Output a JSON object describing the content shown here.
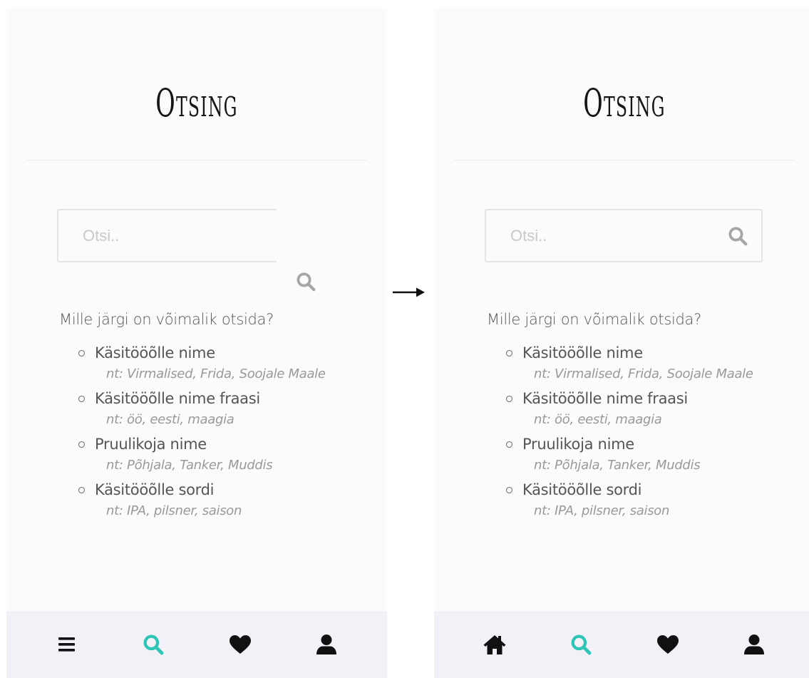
{
  "screens": [
    {
      "title": "Otsing",
      "search": {
        "placeholder": "Otsi.."
      },
      "info": {
        "heading": "Mille järgi on võimalik otsida?",
        "items": [
          {
            "label": "Käsitööõlle nime",
            "example": "nt: Virmalised, Frida, Soojale Maale"
          },
          {
            "label": "Käsitööõlle nime fraasi",
            "example": "nt: öö, eesti, maagia"
          },
          {
            "label": "Pruulikoja nime",
            "example": "nt: Põhjala, Tanker, Muddis"
          },
          {
            "label": "Käsitööõlle sordi",
            "example": "nt: IPA, pilsner, saison"
          }
        ]
      },
      "navbar": [
        "menu-icon",
        "search-icon",
        "heart-icon",
        "user-icon"
      ]
    },
    {
      "title": "Otsing",
      "search": {
        "placeholder": "Otsi.."
      },
      "info": {
        "heading": "Mille järgi on võimalik otsida?",
        "items": [
          {
            "label": "Käsitööõlle nime",
            "example": "nt: Virmalised, Frida, Soojale Maale"
          },
          {
            "label": "Käsitööõlle nime fraasi",
            "example": "nt: öö, eesti, maagia"
          },
          {
            "label": "Pruulikoja nime",
            "example": "nt: Põhjala, Tanker, Muddis"
          },
          {
            "label": "Käsitööõlle sordi",
            "example": "nt: IPA, pilsner, saison"
          }
        ]
      },
      "navbar": [
        "home-icon",
        "search-icon",
        "heart-icon",
        "user-icon"
      ]
    }
  ],
  "colors": {
    "active_icon": "#2ec4b6",
    "icon": "#111111",
    "search_icon": "#a6a6a6",
    "navbar_bg": "#f3f1f8"
  }
}
